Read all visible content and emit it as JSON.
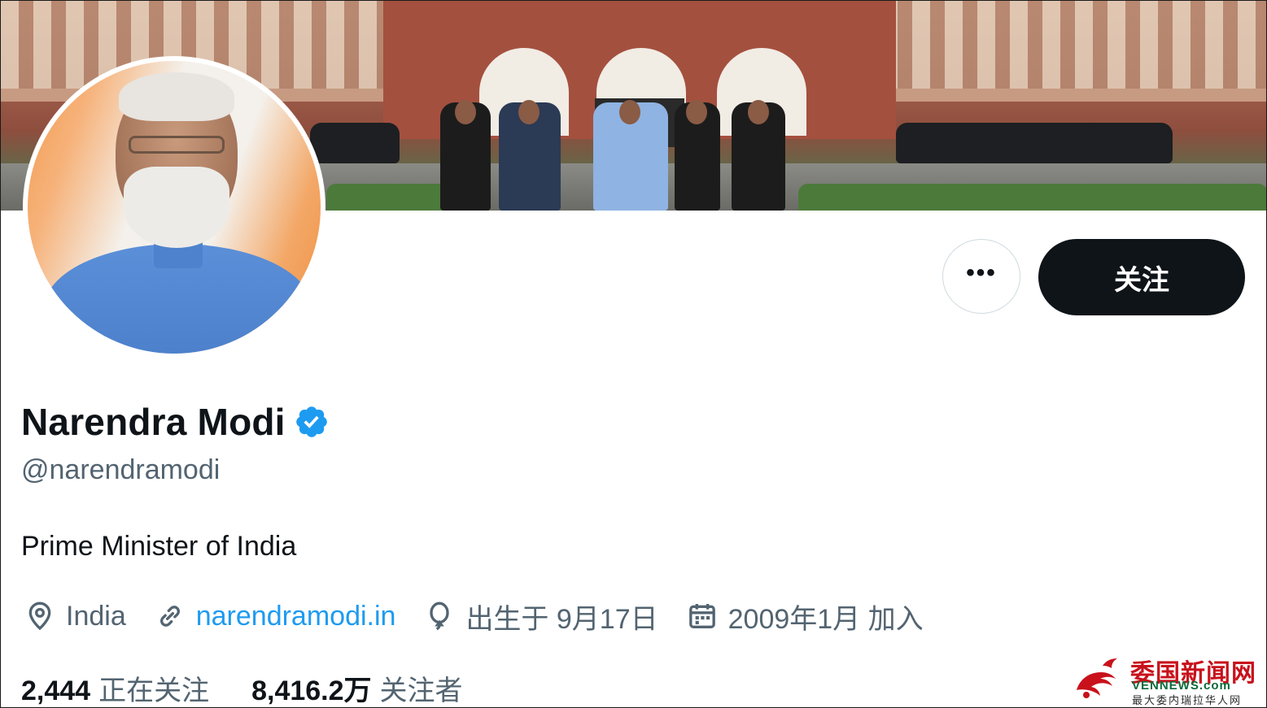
{
  "profile": {
    "display_name": "Narendra Modi",
    "handle": "@narendramodi",
    "bio": "Prime Minister of India",
    "verified": true
  },
  "actions": {
    "more_label": "•••",
    "follow_label": "关注"
  },
  "meta": {
    "location": "India",
    "website": "narendramodi.in",
    "birthday": "出生于 9月17日",
    "joined": "2009年1月 加入"
  },
  "stats": {
    "following_count": "2,444",
    "following_label": "正在关注",
    "followers_count": "8,416.2万",
    "followers_label": "关注者"
  },
  "watermark": {
    "title": "委国新闻网",
    "domain": "VENNEWS.com",
    "subtitle": "最大委内瑞拉华人网"
  },
  "colors": {
    "accent_link": "#1d9bf0",
    "verified_badge": "#1d9bf0",
    "follow_button_bg": "#0f1419",
    "secondary_text": "#536471",
    "watermark_red": "#c8111b",
    "watermark_green": "#0a6a3a"
  },
  "icons": {
    "location": "map-pin-icon",
    "website": "link-icon",
    "birthday": "balloon-icon",
    "joined": "calendar-icon",
    "verified": "verified-badge-icon"
  }
}
